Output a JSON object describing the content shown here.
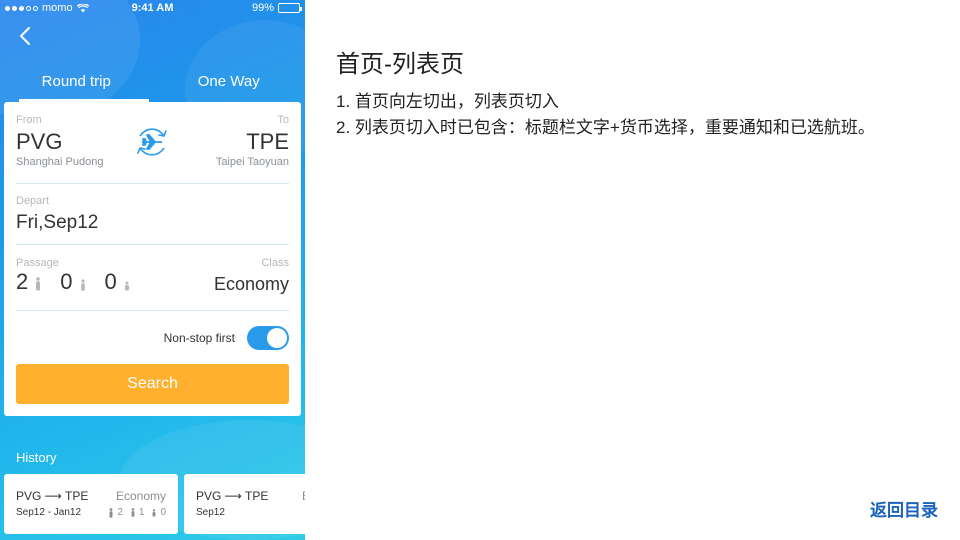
{
  "status": {
    "carrier": "momo",
    "time": "9:41 AM",
    "battery": "99%",
    "battery_level": 0.99
  },
  "tabs": [
    {
      "label": "Round trip"
    },
    {
      "label": "One Way"
    }
  ],
  "route": {
    "from_label": "From",
    "from_code": "PVG",
    "from_name": "Shanghai Pudong",
    "to_label": "To",
    "to_code": "TPE",
    "to_name": "Taipei Taoyuan"
  },
  "depart": {
    "label": "Depart",
    "value": "Fri,Sep12"
  },
  "passengers": {
    "label": "Passage",
    "adults": "2",
    "children": "0",
    "infants": "0"
  },
  "class": {
    "label": "Class",
    "value": "Economy"
  },
  "nonstop": {
    "label": "Non-stop first",
    "on": true
  },
  "search": {
    "label": "Search"
  },
  "history": {
    "title": "History",
    "items": [
      {
        "route": "PVG ⟶ TPE",
        "class": "Economy",
        "dates": "Sep12 - Jan12",
        "adults": "2",
        "children": "1",
        "infants": "0"
      },
      {
        "route": "PVG ⟶ TPE",
        "class": "Ec",
        "dates": "Sep12"
      }
    ]
  },
  "notes": {
    "title": "首页-列表页",
    "items": [
      "1. 首页向左切出，列表页切入",
      "2. 列表页切入时已包含：标题栏文字+货币选择，重要通知和已选航班。"
    ]
  },
  "return_link": "返回目录",
  "colors": {
    "accent": "#2a9aeb",
    "search": "#ffb02e",
    "link": "#1a63b8"
  }
}
